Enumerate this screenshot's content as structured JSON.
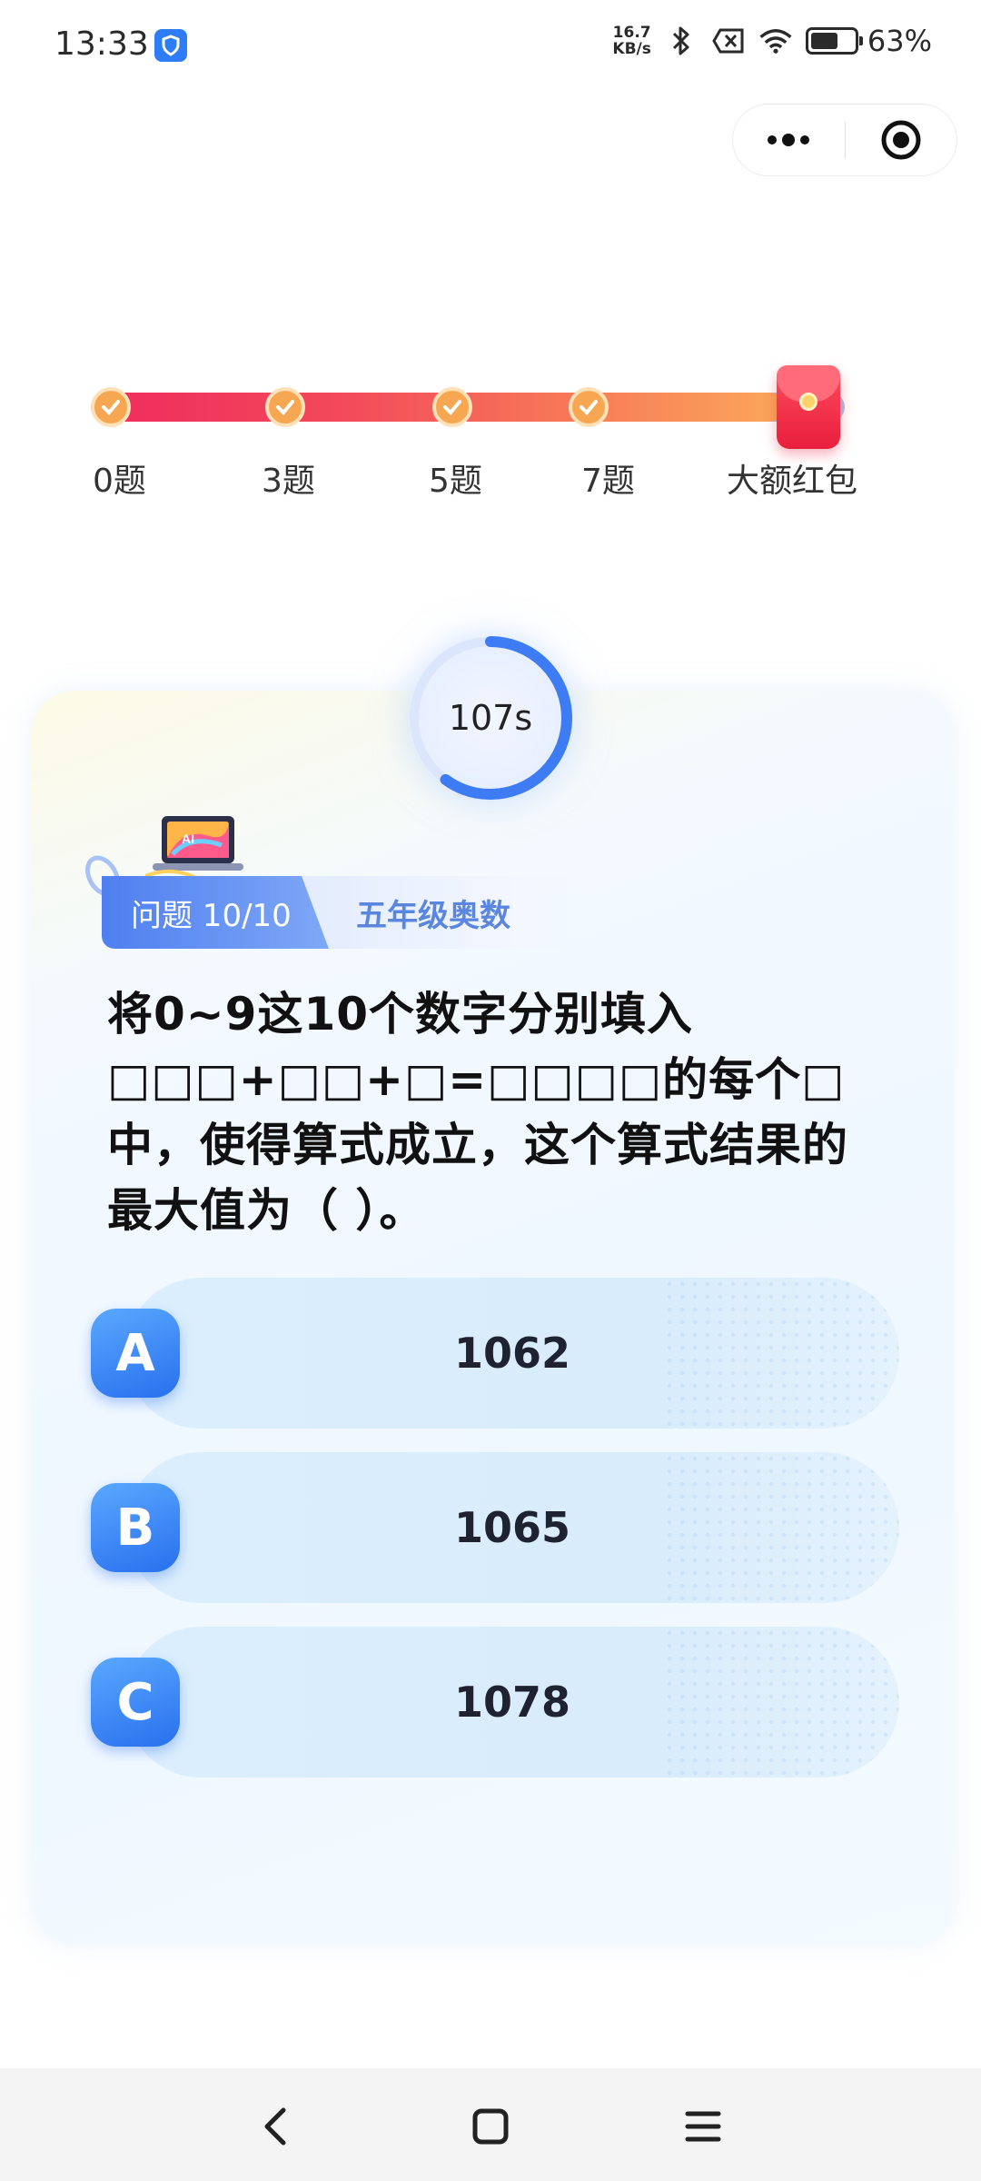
{
  "status_bar": {
    "time": "13:33",
    "app_icon": "shield-app-icon",
    "net_speed_value": "16.7",
    "net_speed_unit": "KB/s",
    "icons": [
      "bluetooth-icon",
      "sim-disabled-icon",
      "wifi-icon"
    ],
    "battery_percent": "63",
    "battery_text": "63%",
    "battery_level": 0.63
  },
  "capsule": {
    "more_icon": "more-dots-icon",
    "close_icon": "close-target-icon"
  },
  "progress": {
    "fill_fraction": 0.92,
    "milestones": [
      {
        "label": "0题",
        "completed": true
      },
      {
        "label": "3题",
        "completed": true
      },
      {
        "label": "5题",
        "completed": true
      },
      {
        "label": "7题",
        "completed": true
      }
    ],
    "reward": {
      "label": "大额红包",
      "icon": "red-envelope-icon"
    }
  },
  "timer": {
    "text": "107s",
    "remaining_fraction": 0.6
  },
  "question_header": {
    "number": "问题 10/10",
    "category": "五年级奥数",
    "sticker_icon": "ai-laptop-sticker-icon"
  },
  "question": {
    "text": "将0~9这10个数字分别填入□□□+□□+□=□□□□的每个□中，使得算式成立，这个算式结果的最大值为（ ）。"
  },
  "options": [
    {
      "letter": "A",
      "value": "1062"
    },
    {
      "letter": "B",
      "value": "1065"
    },
    {
      "letter": "C",
      "value": "1078"
    }
  ],
  "nav": {
    "back_icon": "back-chevron-icon",
    "home_icon": "home-square-icon",
    "menu_icon": "menu-lines-icon"
  },
  "colors": {
    "accent_blue": "#2f7df6",
    "progress_start": "#ef2a5d",
    "progress_end": "#fba75a",
    "track": "#a7c1ec",
    "option_bg": "#d8ecfc"
  }
}
